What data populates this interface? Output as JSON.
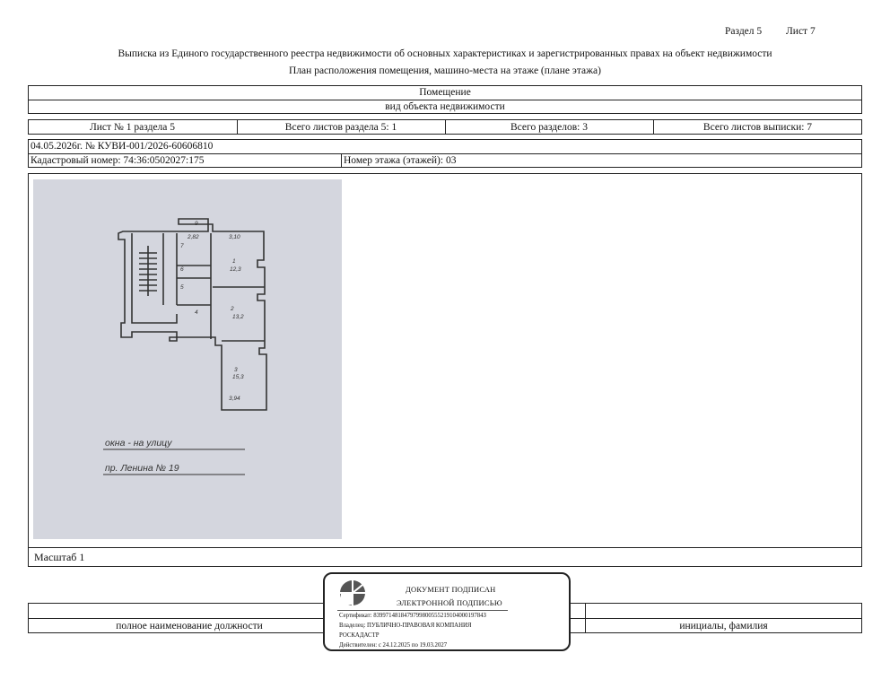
{
  "header": {
    "section": "Раздел 5",
    "sheet": "Лист 7",
    "title_line1": "Выписка из Единого государственного реестра недвижимости об основных характеристиках и зарегистрированных правах на объект недвижимости",
    "title_line2": "План расположения помещения, машино-места на этаже (плане этажа)"
  },
  "object_block": {
    "kind": "Помещение",
    "kind_caption": "вид объекта недвижимости"
  },
  "sheets_row": {
    "sheet_of_section": "Лист № 1 раздела 5",
    "total_sheets_section": "Всего листов раздела 5: 1",
    "total_sections": "Всего разделов: 3",
    "total_sheets_extract": "Всего листов выписки: 7"
  },
  "doc_info": {
    "date_number": "04.05.2026г. № КУВИ-001/2026-60606810",
    "cadastral_label": "Кадастровый номер: 74:36:0502027:175",
    "floor_label": "Номер этажа (этажей): 03"
  },
  "plan": {
    "annotation_line1": "окна - на улицу",
    "annotation_line2": "пр. Ленина № 19",
    "room_labels": [
      "9",
      "1",
      "2",
      "3",
      "4",
      "5",
      "6",
      "7"
    ],
    "area_labels": [
      "12,3",
      "13,2",
      "15,3"
    ],
    "dim_labels": [
      "3,10",
      "2,82",
      "3,94"
    ]
  },
  "scale": {
    "label": "Масштаб 1"
  },
  "footer": {
    "position_caption": "полное наименование должности",
    "name_caption": "инициалы, фамилия"
  },
  "stamp": {
    "line1": "ДОКУМЕНТ ПОДПИСАН",
    "line2": "ЭЛЕКТРОННОЙ ПОДПИСЬЮ",
    "cert": "Сертификат: 839971481847979980055521910400019784З",
    "owner1": "Владелец: ПУБЛИЧНО-ПРАВОВАЯ КОМПАНИЯ",
    "owner2": "РОСКАДАСТР",
    "valid": "Действителен: с 24.12.2025 по 19.03.2027"
  }
}
